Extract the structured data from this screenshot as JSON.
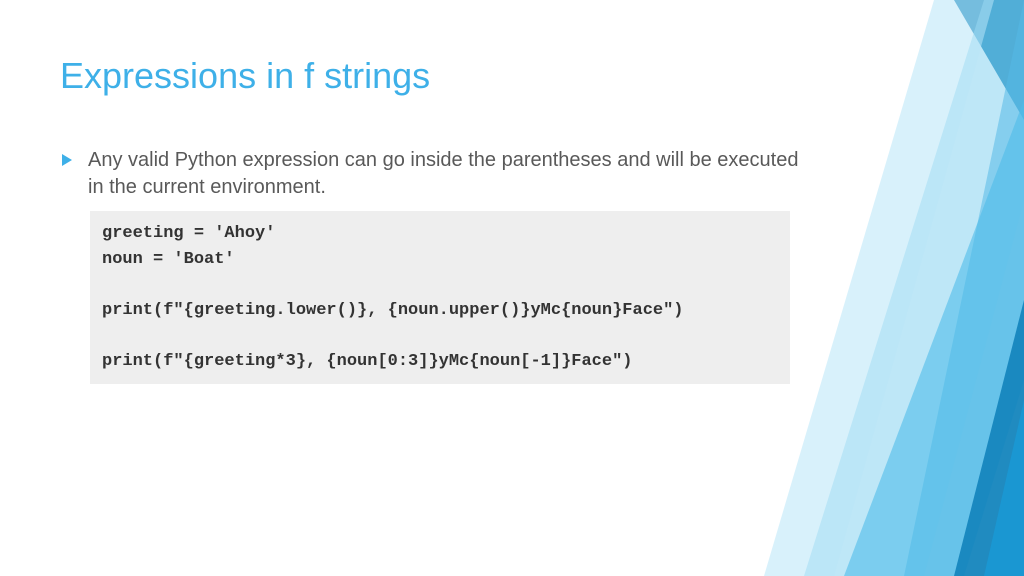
{
  "title": "Expressions in f strings",
  "bullet": "Any valid Python expression can go inside the parentheses and will be executed in the current environment.",
  "code": "greeting = 'Ahoy'\nnoun = 'Boat'\n\nprint(f\"{greeting.lower()}, {noun.upper()}yMc{noun}Face\")\n\nprint(f\"{greeting*3}, {noun[0:3]}yMc{noun[-1]}Face\")"
}
